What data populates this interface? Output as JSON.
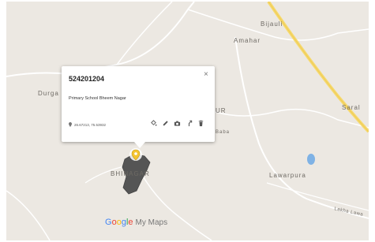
{
  "map": {
    "place_labels": [
      {
        "name": "Bijauli"
      },
      {
        "name": "Amahar"
      },
      {
        "name": "Durga"
      },
      {
        "name": "UR"
      },
      {
        "name": "BHINAGAR"
      },
      {
        "name": "Saral"
      },
      {
        "name": "Lawarpura"
      },
      {
        "name": "Lakha Lawa"
      },
      {
        "name": "Baba"
      }
    ],
    "colors": {
      "land": "#ece8e2",
      "minor_road": "#ffffff",
      "highway": "#f6d96b",
      "polygon": "#555555",
      "water": "#7fb2e5",
      "marker": "#f4c430"
    },
    "marker_icon": "map-pin-icon"
  },
  "popup": {
    "title": "524201204",
    "description": "Primary School Bheem Nagar",
    "coordinates": "26.67213, 75.53932",
    "close_symbol": "×",
    "tools": [
      {
        "name": "paint-bucket-icon"
      },
      {
        "name": "pencil-icon"
      },
      {
        "name": "camera-icon"
      },
      {
        "name": "directions-icon"
      },
      {
        "name": "trash-icon"
      }
    ]
  },
  "branding": {
    "google": "Google",
    "product": "My Maps"
  }
}
